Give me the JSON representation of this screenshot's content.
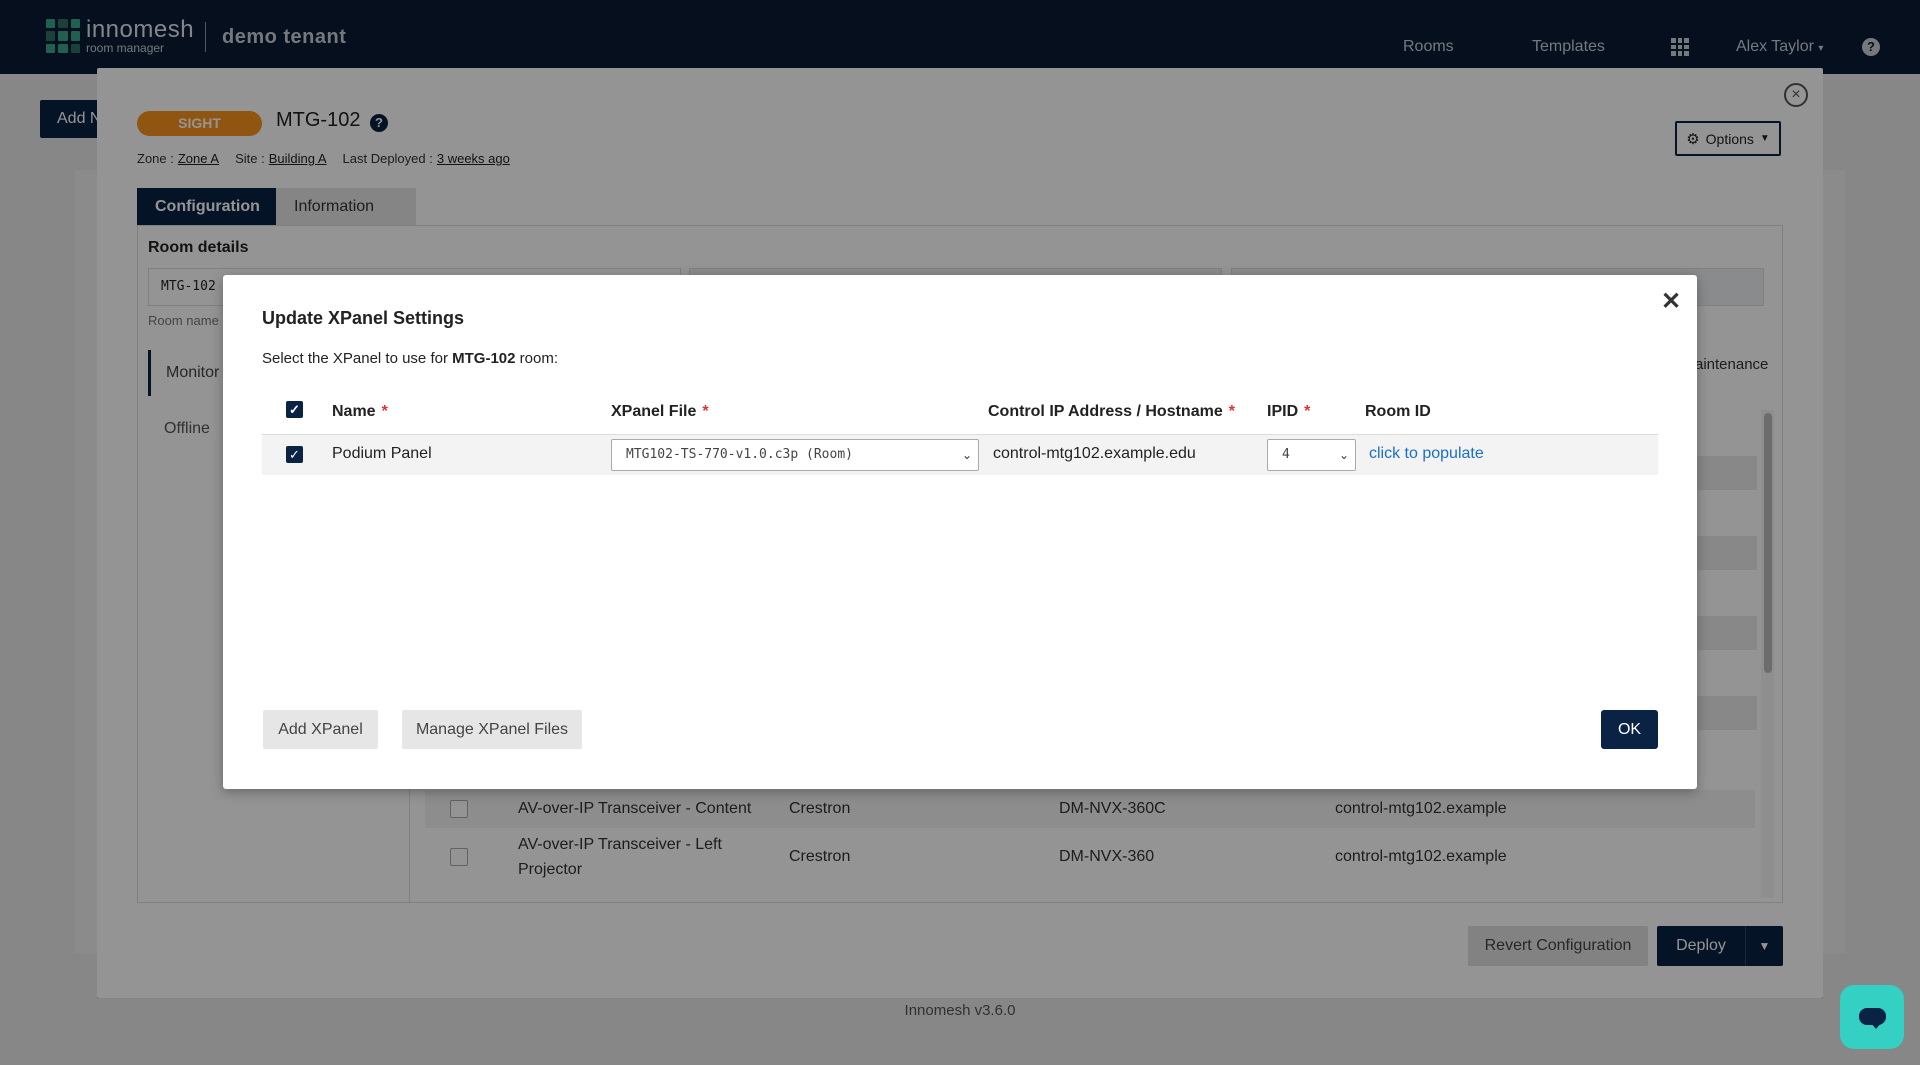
{
  "topbar": {
    "logo_brand": "innomesh",
    "logo_sub": "room manager",
    "tenant": "demo tenant",
    "nav": [
      "Rooms",
      "Templates"
    ],
    "user": "Alex Taylor",
    "help": "?"
  },
  "background": {
    "add_button": "Add N",
    "version": "Innomesh v3.6.0"
  },
  "room_modal": {
    "badge": "SIGHT",
    "title": "MTG-102",
    "zone_label": "Zone :",
    "zone_value": "Zone A",
    "site_label": "Site :",
    "site_value": "Building A",
    "deployed_label": "Last Deployed :",
    "deployed_value": "3 weeks ago",
    "options_label": "Options",
    "tabs": [
      {
        "label": "Configuration",
        "active": true
      },
      {
        "label": "Information",
        "active": false
      }
    ],
    "room_details_heading": "Room details",
    "room_name_value": "MTG-102",
    "room_name_label": "Room name",
    "monitor_tab": "Monitor",
    "offline_tab": "Offline",
    "maintenance_text": "aintenance",
    "device_rows": [
      {
        "name": "AV-over-IP Transceiver - Content",
        "make": "Crestron",
        "model": "DM-NVX-360C",
        "address": "control-mtg102.example"
      },
      {
        "name": "AV-over-IP Transceiver - Left Projector",
        "make": "Crestron",
        "model": "DM-NVX-360",
        "address": "control-mtg102.example"
      }
    ],
    "revert_label": "Revert Configuration",
    "deploy_label": "Deploy"
  },
  "xpanel_modal": {
    "title": "Update XPanel Settings",
    "subtitle_pre": "Select the XPanel to use for",
    "subtitle_room": "MTG-102",
    "subtitle_post": "room:",
    "columns": {
      "name": "Name",
      "file": "XPanel File",
      "ip": "Control IP Address / Hostname",
      "ipid": "IPID",
      "room_id": "Room ID"
    },
    "required_mark": "*",
    "rows": [
      {
        "checked": true,
        "name": "Podium Panel",
        "file": "MTG102-TS-770-v1.0.c3p (Room)",
        "ip": "control-mtg102.example.edu",
        "ipid": "4",
        "room_id": "click to populate"
      }
    ],
    "add_button": "Add XPanel",
    "manage_button": "Manage XPanel Files",
    "ok_button": "OK"
  },
  "colors": {
    "navy": "#0a2244",
    "badge_orange": "#f7931e",
    "link_blue": "#1a6fc9",
    "chat_teal": "#35d0c4"
  },
  "icons": [
    "grid-icon",
    "help-icon",
    "close-circle-icon",
    "gear-icon",
    "caret-down-icon",
    "close-icon",
    "check-icon",
    "chat-icon"
  ]
}
